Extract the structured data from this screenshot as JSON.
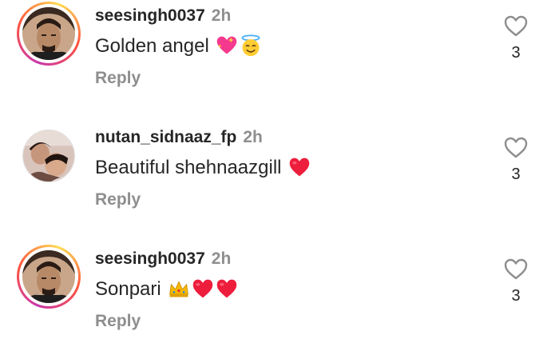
{
  "comments": [
    {
      "username": "seesingh0037",
      "time": "2h",
      "text": "Golden angel",
      "emoji": [
        "sparkling-heart",
        "smiling-face-with-halo"
      ],
      "reply_label": "Reply",
      "like_count": "3",
      "avatar_ring": true
    },
    {
      "username": "nutan_sidnaaz_fp",
      "time": "2h",
      "text": "Beautiful shehnaazgill",
      "emoji": [
        "red-heart"
      ],
      "reply_label": "Reply",
      "like_count": "3",
      "avatar_ring": false
    },
    {
      "username": "seesingh0037",
      "time": "2h",
      "text": "Sonpari",
      "emoji": [
        "crown",
        "red-heart",
        "red-heart"
      ],
      "reply_label": "Reply",
      "like_count": "3",
      "avatar_ring": true
    }
  ],
  "colors": {
    "text_primary": "#262626",
    "text_secondary": "#8e8e8e",
    "heart_red": "#ed1e3c",
    "ring_gradient": [
      "#c837ab",
      "#ff543e",
      "#ffdd55"
    ]
  }
}
